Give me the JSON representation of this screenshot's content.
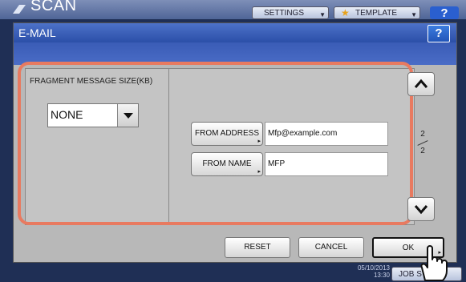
{
  "background": {
    "title": "SCAN",
    "settings_label": "SETTINGS",
    "template_label": "TEMPLATE",
    "help_label": "?",
    "date_line1": "05/10/2013",
    "date_line2": "13:30",
    "job_status_label": "JOB ST"
  },
  "dialog": {
    "title": "E-MAIL",
    "help_label": "?",
    "fragment_label": "FRAGMENT MESSAGE SIZE(KB)",
    "fragment_value": "NONE",
    "from_address_label": "FROM ADDRESS",
    "from_address_value": "Mfp@example.com",
    "from_name_label": "FROM NAME",
    "from_name_value": "MFP",
    "page_current": "2",
    "page_total": "2",
    "reset_label": "RESET",
    "cancel_label": "CANCEL",
    "ok_label": "OK"
  },
  "colors": {
    "highlight": "#e87a60",
    "title_bar": "#2b4fa8",
    "panel": "#c4c4c4"
  }
}
